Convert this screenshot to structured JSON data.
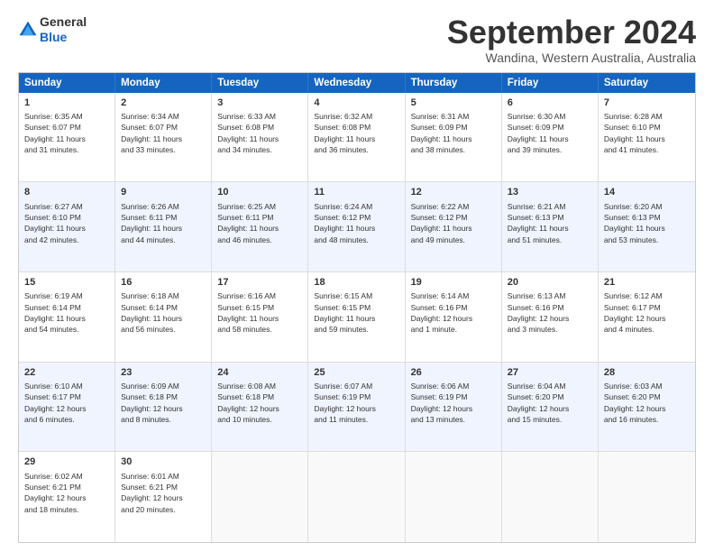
{
  "header": {
    "logo_general": "General",
    "logo_blue": "Blue",
    "month": "September 2024",
    "location": "Wandina, Western Australia, Australia"
  },
  "days": [
    "Sunday",
    "Monday",
    "Tuesday",
    "Wednesday",
    "Thursday",
    "Friday",
    "Saturday"
  ],
  "rows": [
    [
      {
        "num": "1",
        "text": "Sunrise: 6:35 AM\nSunset: 6:07 PM\nDaylight: 11 hours\nand 31 minutes."
      },
      {
        "num": "2",
        "text": "Sunrise: 6:34 AM\nSunset: 6:07 PM\nDaylight: 11 hours\nand 33 minutes."
      },
      {
        "num": "3",
        "text": "Sunrise: 6:33 AM\nSunset: 6:08 PM\nDaylight: 11 hours\nand 34 minutes."
      },
      {
        "num": "4",
        "text": "Sunrise: 6:32 AM\nSunset: 6:08 PM\nDaylight: 11 hours\nand 36 minutes."
      },
      {
        "num": "5",
        "text": "Sunrise: 6:31 AM\nSunset: 6:09 PM\nDaylight: 11 hours\nand 38 minutes."
      },
      {
        "num": "6",
        "text": "Sunrise: 6:30 AM\nSunset: 6:09 PM\nDaylight: 11 hours\nand 39 minutes."
      },
      {
        "num": "7",
        "text": "Sunrise: 6:28 AM\nSunset: 6:10 PM\nDaylight: 11 hours\nand 41 minutes."
      }
    ],
    [
      {
        "num": "8",
        "text": "Sunrise: 6:27 AM\nSunset: 6:10 PM\nDaylight: 11 hours\nand 42 minutes."
      },
      {
        "num": "9",
        "text": "Sunrise: 6:26 AM\nSunset: 6:11 PM\nDaylight: 11 hours\nand 44 minutes."
      },
      {
        "num": "10",
        "text": "Sunrise: 6:25 AM\nSunset: 6:11 PM\nDaylight: 11 hours\nand 46 minutes."
      },
      {
        "num": "11",
        "text": "Sunrise: 6:24 AM\nSunset: 6:12 PM\nDaylight: 11 hours\nand 48 minutes."
      },
      {
        "num": "12",
        "text": "Sunrise: 6:22 AM\nSunset: 6:12 PM\nDaylight: 11 hours\nand 49 minutes."
      },
      {
        "num": "13",
        "text": "Sunrise: 6:21 AM\nSunset: 6:13 PM\nDaylight: 11 hours\nand 51 minutes."
      },
      {
        "num": "14",
        "text": "Sunrise: 6:20 AM\nSunset: 6:13 PM\nDaylight: 11 hours\nand 53 minutes."
      }
    ],
    [
      {
        "num": "15",
        "text": "Sunrise: 6:19 AM\nSunset: 6:14 PM\nDaylight: 11 hours\nand 54 minutes."
      },
      {
        "num": "16",
        "text": "Sunrise: 6:18 AM\nSunset: 6:14 PM\nDaylight: 11 hours\nand 56 minutes."
      },
      {
        "num": "17",
        "text": "Sunrise: 6:16 AM\nSunset: 6:15 PM\nDaylight: 11 hours\nand 58 minutes."
      },
      {
        "num": "18",
        "text": "Sunrise: 6:15 AM\nSunset: 6:15 PM\nDaylight: 11 hours\nand 59 minutes."
      },
      {
        "num": "19",
        "text": "Sunrise: 6:14 AM\nSunset: 6:16 PM\nDaylight: 12 hours\nand 1 minute."
      },
      {
        "num": "20",
        "text": "Sunrise: 6:13 AM\nSunset: 6:16 PM\nDaylight: 12 hours\nand 3 minutes."
      },
      {
        "num": "21",
        "text": "Sunrise: 6:12 AM\nSunset: 6:17 PM\nDaylight: 12 hours\nand 4 minutes."
      }
    ],
    [
      {
        "num": "22",
        "text": "Sunrise: 6:10 AM\nSunset: 6:17 PM\nDaylight: 12 hours\nand 6 minutes."
      },
      {
        "num": "23",
        "text": "Sunrise: 6:09 AM\nSunset: 6:18 PM\nDaylight: 12 hours\nand 8 minutes."
      },
      {
        "num": "24",
        "text": "Sunrise: 6:08 AM\nSunset: 6:18 PM\nDaylight: 12 hours\nand 10 minutes."
      },
      {
        "num": "25",
        "text": "Sunrise: 6:07 AM\nSunset: 6:19 PM\nDaylight: 12 hours\nand 11 minutes."
      },
      {
        "num": "26",
        "text": "Sunrise: 6:06 AM\nSunset: 6:19 PM\nDaylight: 12 hours\nand 13 minutes."
      },
      {
        "num": "27",
        "text": "Sunrise: 6:04 AM\nSunset: 6:20 PM\nDaylight: 12 hours\nand 15 minutes."
      },
      {
        "num": "28",
        "text": "Sunrise: 6:03 AM\nSunset: 6:20 PM\nDaylight: 12 hours\nand 16 minutes."
      }
    ],
    [
      {
        "num": "29",
        "text": "Sunrise: 6:02 AM\nSunset: 6:21 PM\nDaylight: 12 hours\nand 18 minutes."
      },
      {
        "num": "30",
        "text": "Sunrise: 6:01 AM\nSunset: 6:21 PM\nDaylight: 12 hours\nand 20 minutes."
      },
      {
        "num": "",
        "text": ""
      },
      {
        "num": "",
        "text": ""
      },
      {
        "num": "",
        "text": ""
      },
      {
        "num": "",
        "text": ""
      },
      {
        "num": "",
        "text": ""
      }
    ]
  ]
}
